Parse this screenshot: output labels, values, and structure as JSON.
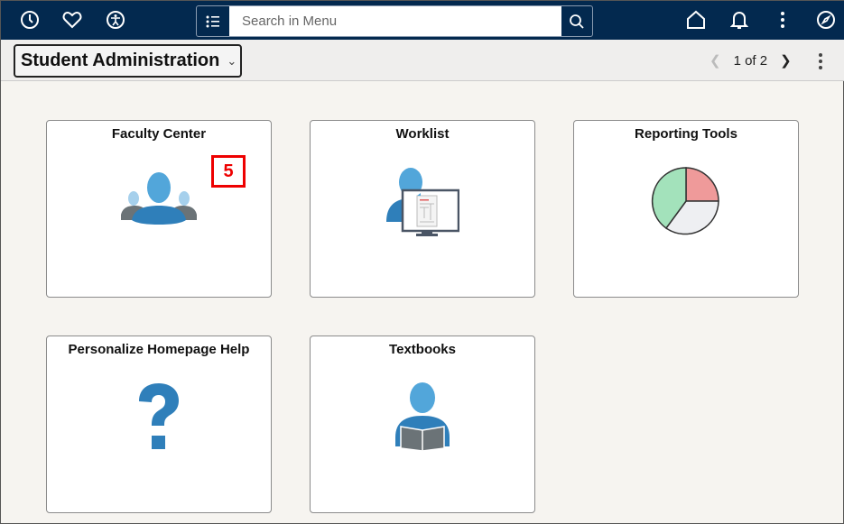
{
  "header": {
    "search_placeholder": "Search in Menu"
  },
  "subheader": {
    "homepage": "Student Administration",
    "pager": "1 of 2"
  },
  "tiles": [
    {
      "title": "Faculty Center",
      "badge": "5"
    },
    {
      "title": "Worklist"
    },
    {
      "title": "Reporting Tools"
    },
    {
      "title": "Personalize Homepage Help"
    },
    {
      "title": "Textbooks"
    }
  ],
  "colors": {
    "header": "#03294f",
    "icon_blue": "#2f7fba",
    "badge": "#ee0000"
  }
}
